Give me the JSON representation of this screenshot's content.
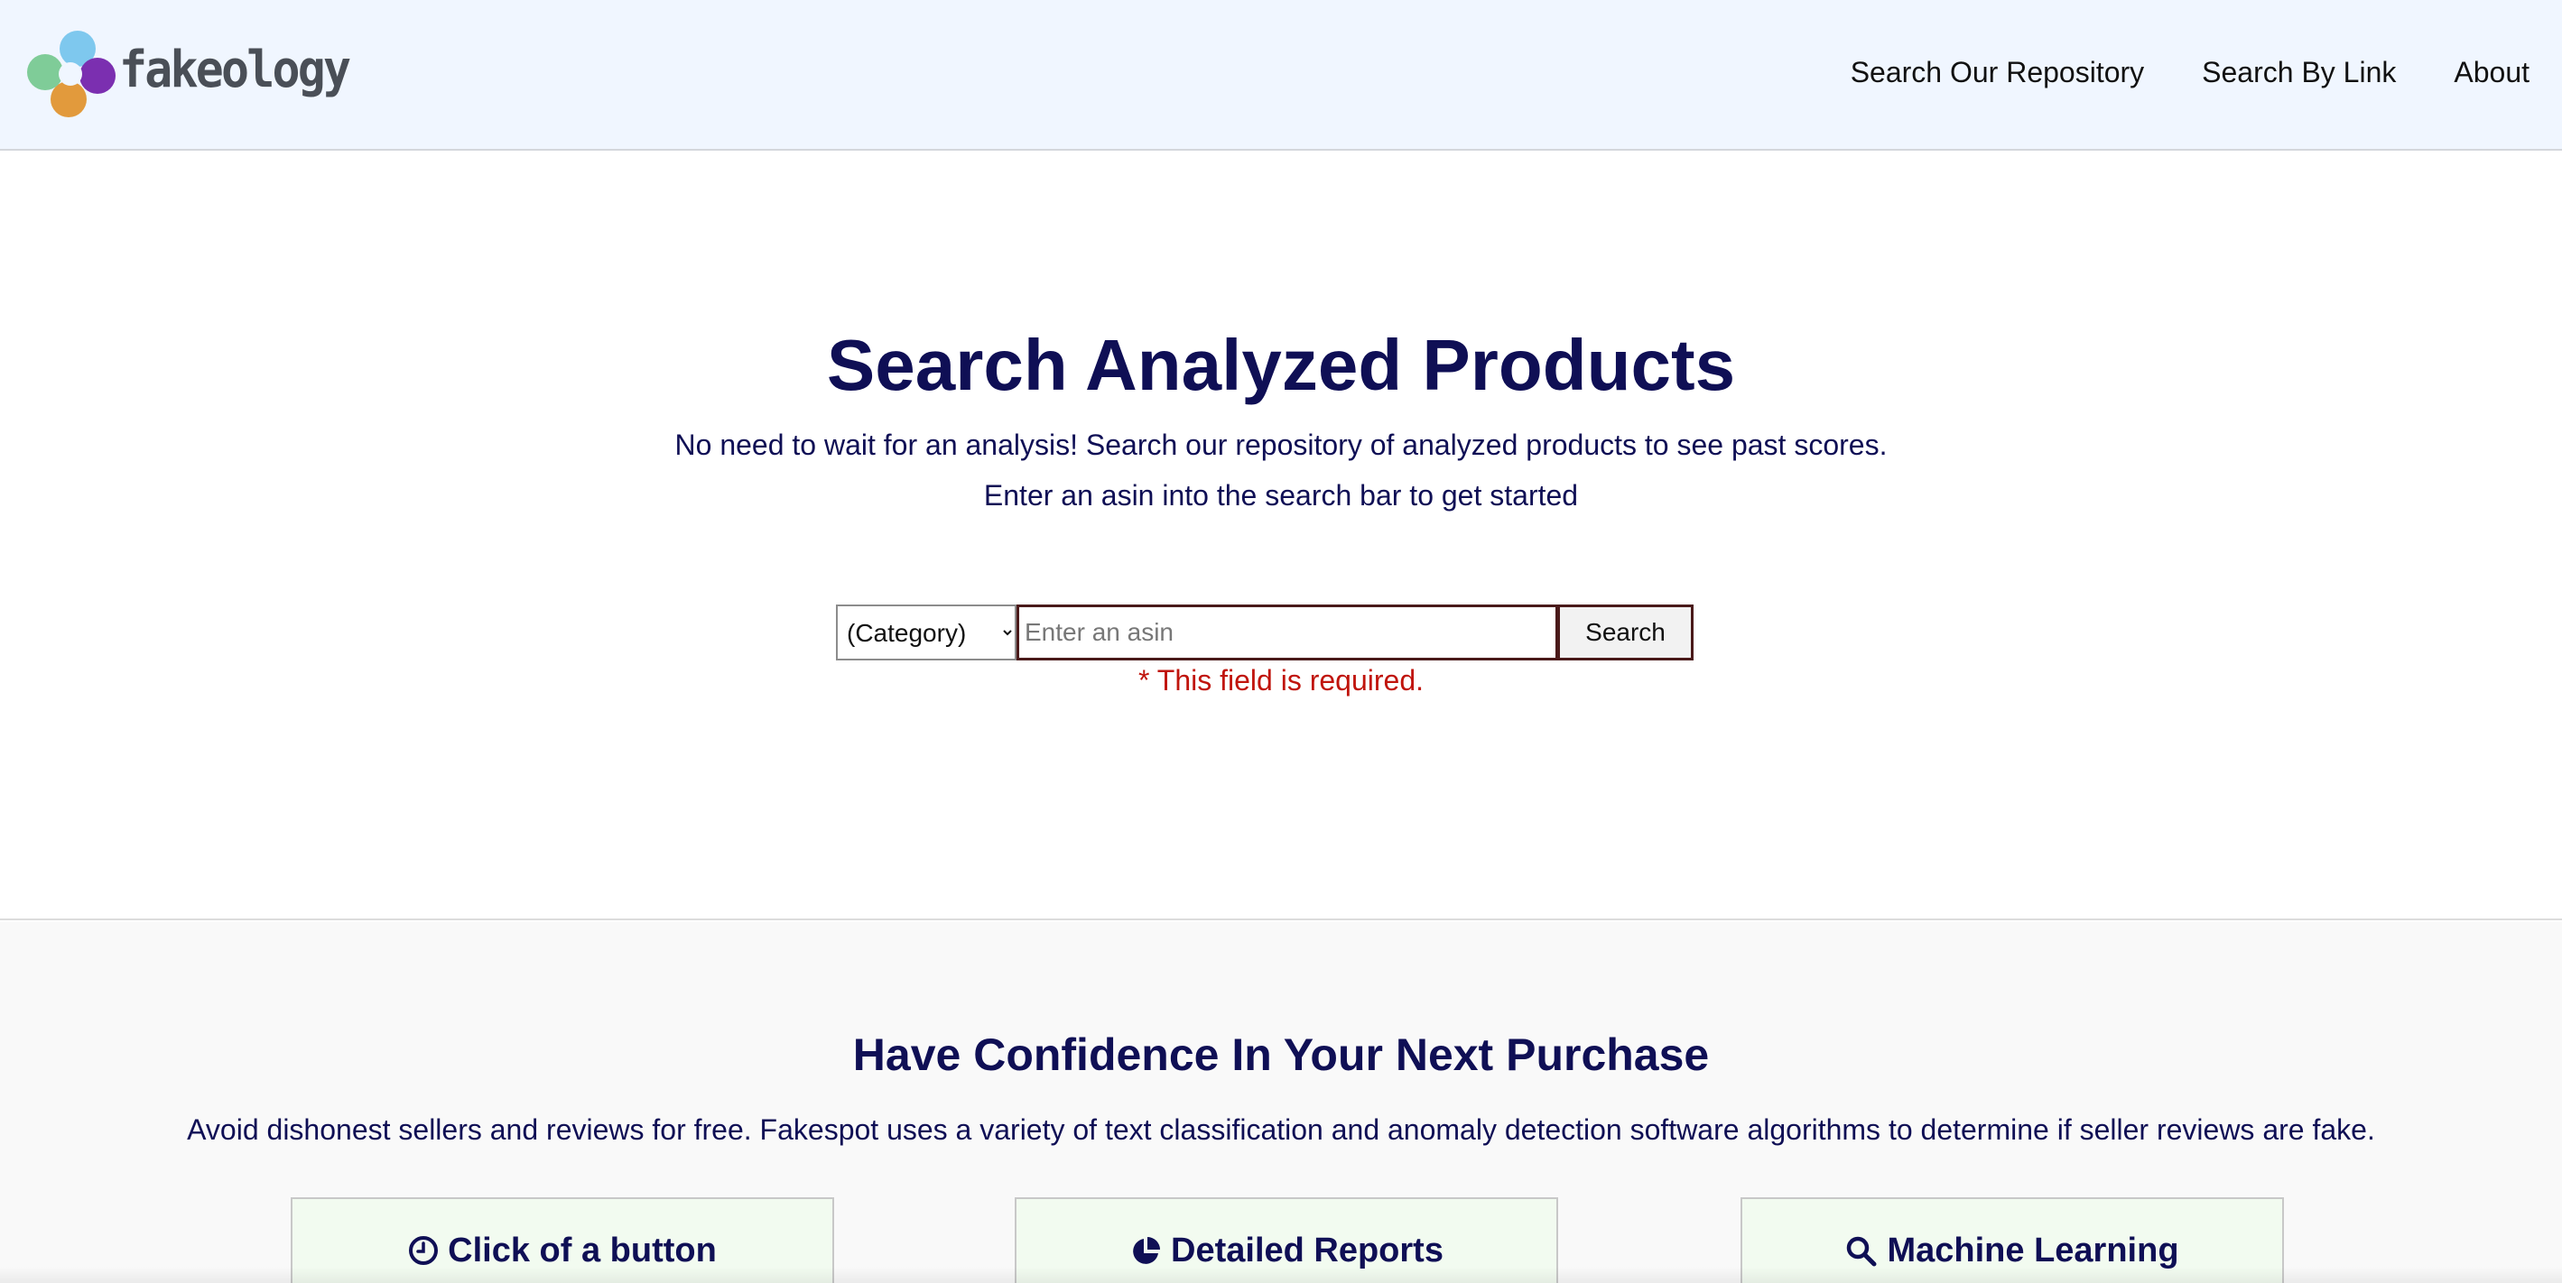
{
  "header": {
    "logo_text": "fakeology",
    "nav": [
      {
        "label": "Search Our Repository"
      },
      {
        "label": "Search By Link"
      },
      {
        "label": "About"
      }
    ]
  },
  "hero": {
    "title": "Search Analyzed Products",
    "subtitle_1": "No need to wait for an analysis! Search our repository of analyzed products to see past scores.",
    "subtitle_2": "Enter an asin into the search bar to get started",
    "category_select": {
      "selected": "(Category)"
    },
    "asin_input": {
      "value": "",
      "placeholder": "Enter an asin"
    },
    "search_button": "Search",
    "error_message": "* This field is required."
  },
  "features": {
    "title": "Have Confidence In Your Next Purchase",
    "subtitle": "Avoid dishonest sellers and reviews for free. Fakespot uses a variety of text classification and anomaly detection software algorithms to determine if seller reviews are fake.",
    "cards": [
      {
        "title": "Click of a button",
        "icon": "clock-icon"
      },
      {
        "title": "Detailed Reports",
        "icon": "pie-chart-icon"
      },
      {
        "title": "Machine Learning",
        "icon": "search-icon"
      }
    ]
  },
  "colors": {
    "header_bg": "#f0f6ff",
    "heading_navy": "#0f0f55",
    "error_red": "#c0140c",
    "card_bg": "#f2fbf0"
  }
}
